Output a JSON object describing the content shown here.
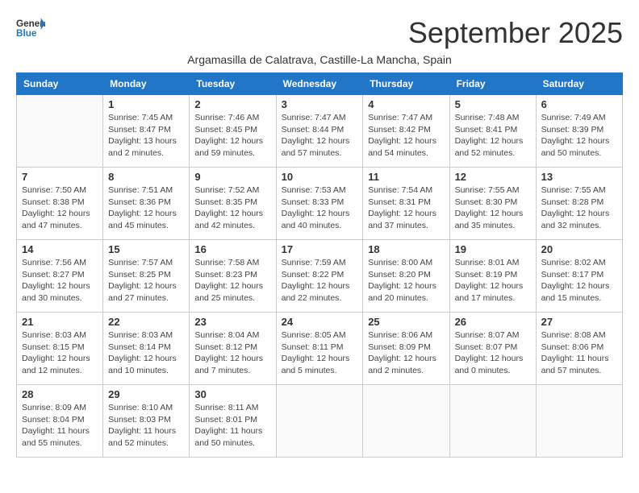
{
  "header": {
    "logo_general": "General",
    "logo_blue": "Blue",
    "month_title": "September 2025",
    "location": "Argamasilla de Calatrava, Castille-La Mancha, Spain"
  },
  "weekdays": [
    "Sunday",
    "Monday",
    "Tuesday",
    "Wednesday",
    "Thursday",
    "Friday",
    "Saturday"
  ],
  "weeks": [
    [
      {
        "day": "",
        "info": ""
      },
      {
        "day": "1",
        "info": "Sunrise: 7:45 AM\nSunset: 8:47 PM\nDaylight: 13 hours\nand 2 minutes."
      },
      {
        "day": "2",
        "info": "Sunrise: 7:46 AM\nSunset: 8:45 PM\nDaylight: 12 hours\nand 59 minutes."
      },
      {
        "day": "3",
        "info": "Sunrise: 7:47 AM\nSunset: 8:44 PM\nDaylight: 12 hours\nand 57 minutes."
      },
      {
        "day": "4",
        "info": "Sunrise: 7:47 AM\nSunset: 8:42 PM\nDaylight: 12 hours\nand 54 minutes."
      },
      {
        "day": "5",
        "info": "Sunrise: 7:48 AM\nSunset: 8:41 PM\nDaylight: 12 hours\nand 52 minutes."
      },
      {
        "day": "6",
        "info": "Sunrise: 7:49 AM\nSunset: 8:39 PM\nDaylight: 12 hours\nand 50 minutes."
      }
    ],
    [
      {
        "day": "7",
        "info": "Sunrise: 7:50 AM\nSunset: 8:38 PM\nDaylight: 12 hours\nand 47 minutes."
      },
      {
        "day": "8",
        "info": "Sunrise: 7:51 AM\nSunset: 8:36 PM\nDaylight: 12 hours\nand 45 minutes."
      },
      {
        "day": "9",
        "info": "Sunrise: 7:52 AM\nSunset: 8:35 PM\nDaylight: 12 hours\nand 42 minutes."
      },
      {
        "day": "10",
        "info": "Sunrise: 7:53 AM\nSunset: 8:33 PM\nDaylight: 12 hours\nand 40 minutes."
      },
      {
        "day": "11",
        "info": "Sunrise: 7:54 AM\nSunset: 8:31 PM\nDaylight: 12 hours\nand 37 minutes."
      },
      {
        "day": "12",
        "info": "Sunrise: 7:55 AM\nSunset: 8:30 PM\nDaylight: 12 hours\nand 35 minutes."
      },
      {
        "day": "13",
        "info": "Sunrise: 7:55 AM\nSunset: 8:28 PM\nDaylight: 12 hours\nand 32 minutes."
      }
    ],
    [
      {
        "day": "14",
        "info": "Sunrise: 7:56 AM\nSunset: 8:27 PM\nDaylight: 12 hours\nand 30 minutes."
      },
      {
        "day": "15",
        "info": "Sunrise: 7:57 AM\nSunset: 8:25 PM\nDaylight: 12 hours\nand 27 minutes."
      },
      {
        "day": "16",
        "info": "Sunrise: 7:58 AM\nSunset: 8:23 PM\nDaylight: 12 hours\nand 25 minutes."
      },
      {
        "day": "17",
        "info": "Sunrise: 7:59 AM\nSunset: 8:22 PM\nDaylight: 12 hours\nand 22 minutes."
      },
      {
        "day": "18",
        "info": "Sunrise: 8:00 AM\nSunset: 8:20 PM\nDaylight: 12 hours\nand 20 minutes."
      },
      {
        "day": "19",
        "info": "Sunrise: 8:01 AM\nSunset: 8:19 PM\nDaylight: 12 hours\nand 17 minutes."
      },
      {
        "day": "20",
        "info": "Sunrise: 8:02 AM\nSunset: 8:17 PM\nDaylight: 12 hours\nand 15 minutes."
      }
    ],
    [
      {
        "day": "21",
        "info": "Sunrise: 8:03 AM\nSunset: 8:15 PM\nDaylight: 12 hours\nand 12 minutes."
      },
      {
        "day": "22",
        "info": "Sunrise: 8:03 AM\nSunset: 8:14 PM\nDaylight: 12 hours\nand 10 minutes."
      },
      {
        "day": "23",
        "info": "Sunrise: 8:04 AM\nSunset: 8:12 PM\nDaylight: 12 hours\nand 7 minutes."
      },
      {
        "day": "24",
        "info": "Sunrise: 8:05 AM\nSunset: 8:11 PM\nDaylight: 12 hours\nand 5 minutes."
      },
      {
        "day": "25",
        "info": "Sunrise: 8:06 AM\nSunset: 8:09 PM\nDaylight: 12 hours\nand 2 minutes."
      },
      {
        "day": "26",
        "info": "Sunrise: 8:07 AM\nSunset: 8:07 PM\nDaylight: 12 hours\nand 0 minutes."
      },
      {
        "day": "27",
        "info": "Sunrise: 8:08 AM\nSunset: 8:06 PM\nDaylight: 11 hours\nand 57 minutes."
      }
    ],
    [
      {
        "day": "28",
        "info": "Sunrise: 8:09 AM\nSunset: 8:04 PM\nDaylight: 11 hours\nand 55 minutes."
      },
      {
        "day": "29",
        "info": "Sunrise: 8:10 AM\nSunset: 8:03 PM\nDaylight: 11 hours\nand 52 minutes."
      },
      {
        "day": "30",
        "info": "Sunrise: 8:11 AM\nSunset: 8:01 PM\nDaylight: 11 hours\nand 50 minutes."
      },
      {
        "day": "",
        "info": ""
      },
      {
        "day": "",
        "info": ""
      },
      {
        "day": "",
        "info": ""
      },
      {
        "day": "",
        "info": ""
      }
    ]
  ]
}
